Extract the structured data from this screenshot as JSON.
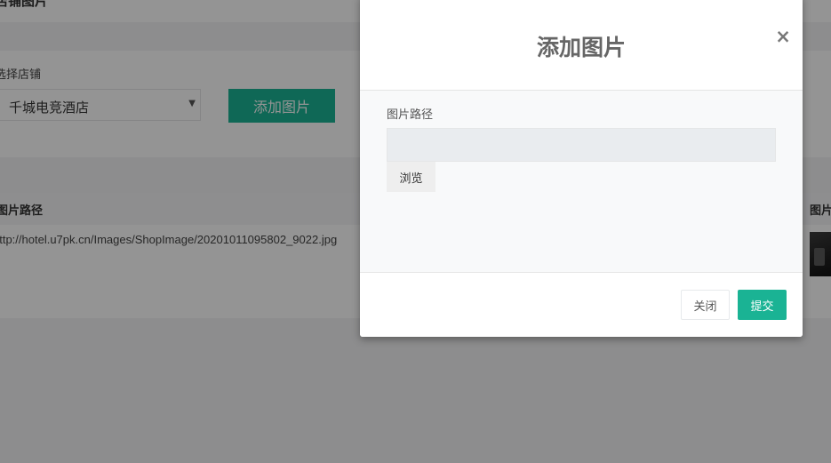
{
  "page": {
    "title": "店铺图片",
    "shop_label": "选择店铺",
    "shop_selected": "千城电竞酒店",
    "add_button_label": "添加图片"
  },
  "table": {
    "headers": [
      "图片路径",
      "图片"
    ],
    "rows": [
      {
        "path": "http://hotel.u7pk.cn/Images/ShopImage/20201011095802_9022.jpg"
      }
    ]
  },
  "modal": {
    "title": "添加图片",
    "close_symbol": "×",
    "field_label": "图片路径",
    "path_value": "",
    "browse_label": "浏览",
    "close_label": "关闭",
    "submit_label": "提交"
  },
  "colors": {
    "accent": "#1ab394",
    "overlay": "rgba(0,0,0,0.42)"
  },
  "icons": {
    "select_arrow": "chevron-down-icon",
    "modal_close": "close-icon"
  }
}
